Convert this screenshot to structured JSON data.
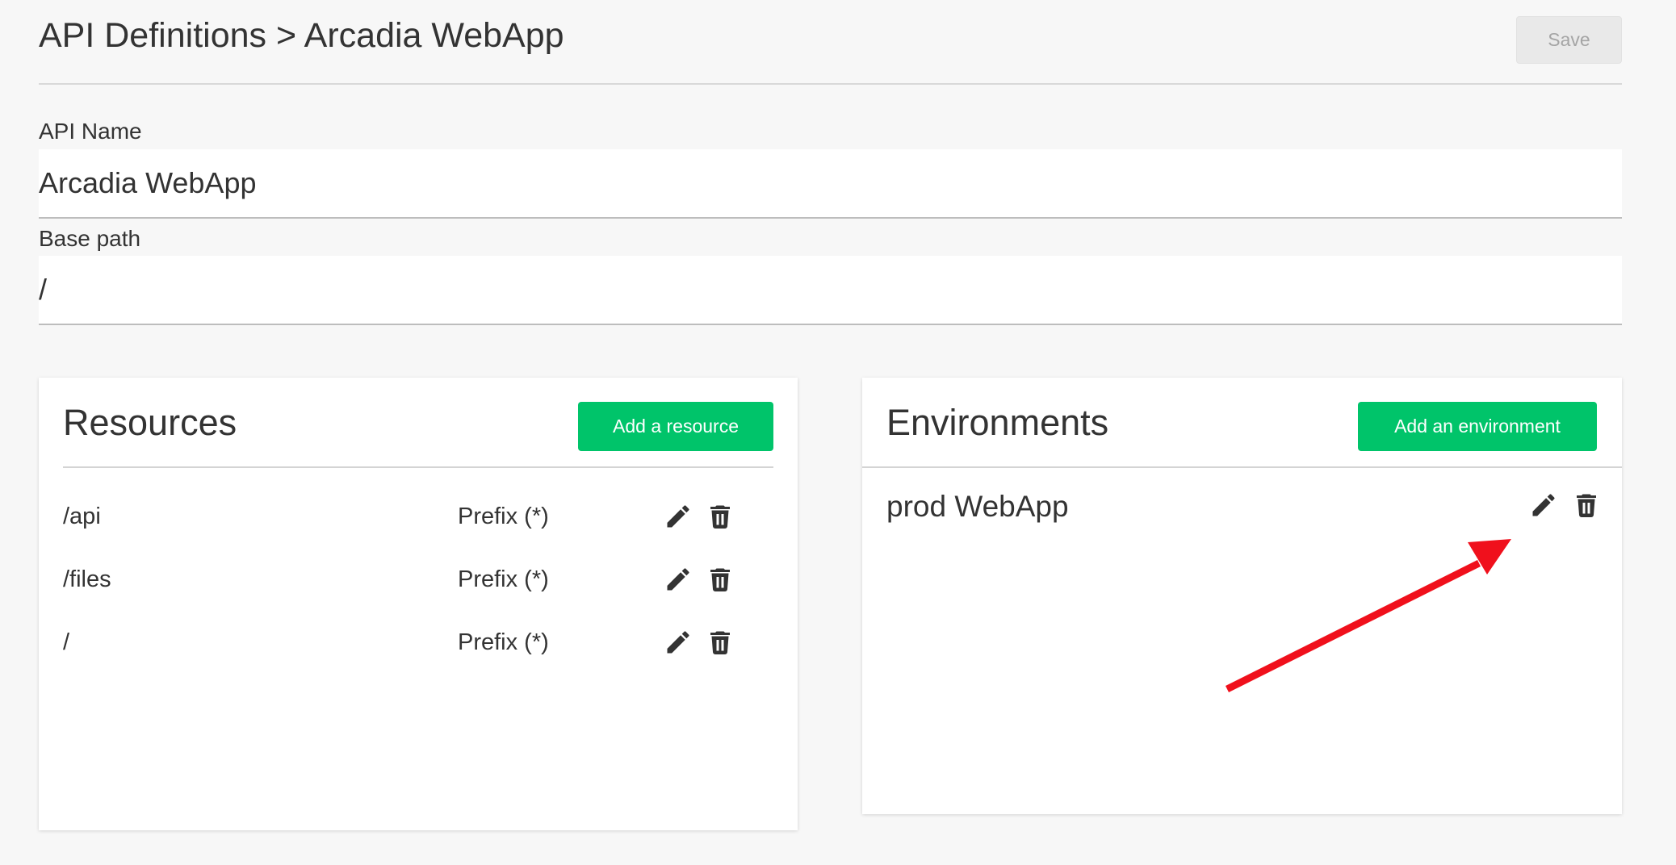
{
  "header": {
    "title": "API Definitions > Arcadia WebApp",
    "save_label": "Save"
  },
  "fields": {
    "api_name": {
      "label": "API Name",
      "value": "Arcadia WebApp"
    },
    "base_path": {
      "label": "Base path",
      "value": "/"
    }
  },
  "resources": {
    "title": "Resources",
    "add_label": "Add a resource",
    "rows": [
      {
        "path": "/api",
        "match": "Prefix (*)",
        "edit_icon": "pencil-icon",
        "delete_icon": "trash-icon"
      },
      {
        "path": "/files",
        "match": "Prefix (*)",
        "edit_icon": "pencil-icon",
        "delete_icon": "trash-icon"
      },
      {
        "path": "/",
        "match": "Prefix (*)",
        "edit_icon": "pencil-icon",
        "delete_icon": "trash-icon"
      }
    ]
  },
  "environments": {
    "title": "Environments",
    "add_label": "Add an environment",
    "items": [
      {
        "name": "prod WebApp",
        "edit_icon": "pencil-icon",
        "delete_icon": "trash-icon"
      }
    ]
  },
  "colors": {
    "accent": "#00c46a",
    "annotation_arrow": "#f0101c",
    "background": "#f7f7f7",
    "text": "#333333"
  }
}
